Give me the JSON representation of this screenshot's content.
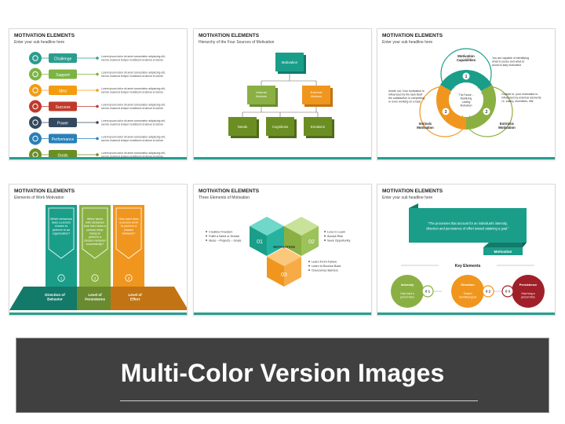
{
  "slides": [
    {
      "title": "MOTIVATION ELEMENTS",
      "subtitle": "Enter your sub headline here",
      "items": [
        "Challenge",
        "Support",
        "Idea",
        "Success",
        "Power",
        "Performance",
        "Goals"
      ],
      "desc_line1": "Lorem ipsum dolor sit amet consectetur adipiscing elit,",
      "desc_line2": "sed do eiusmod tempor incididunt ut labore et dolore",
      "colors": [
        "#2a9d8f",
        "#7cb342",
        "#f39c12",
        "#c0392b",
        "#34495e",
        "#2980b9",
        "#6b8e23"
      ]
    },
    {
      "title": "MOTIVATION ELEMENTS",
      "subtitle": "Hierarchy of the Four Sources of Motivation",
      "root": "Motivation",
      "mid": [
        "Internal Motives",
        "External Motives"
      ],
      "leaves": [
        "Needs",
        "Cognitions",
        "Emotions"
      ]
    },
    {
      "title": "MOTIVATION ELEMENTS",
      "subtitle": "Enter your sub headline here",
      "center": [
        "\"The Factor ...",
        "Mobilizing",
        "Lasting",
        "Motivation"
      ],
      "labels": [
        [
          "Motivation",
          "Capabilities"
        ],
        [
          "Extrinsic",
          "Motivation"
        ],
        [
          "Intrinsic",
          "Motivation"
        ]
      ],
      "nums": [
        "1",
        "2",
        "3"
      ],
      "right_text": [
        "You are  capable of identifying",
        "what to purse and what to",
        "avoid to stay motivated"
      ],
      "left_text": [
        "Inside out: Your motivation is",
        "influenced by the task itself",
        "the satisfaction in completing",
        "or even working on a task"
      ],
      "right2_text": [
        "Outside in: your motivation is",
        "influenced by external elements",
        "i.e. salary, incentives, title"
      ]
    },
    {
      "title": "MOTIVATION ELEMENTS",
      "subtitle": "Elements of Work Motivation",
      "cols": [
        {
          "text": [
            "Which behaviors",
            "does a person",
            "chosen to",
            "perform in an",
            "organization?"
          ],
          "num": "1",
          "label": [
            "Direction of",
            "Behavior"
          ],
          "color": "#1a9e8a",
          "dark": "#137a6a"
        },
        {
          "text": [
            "When faced",
            "with obstacles",
            "how hard does a",
            "person keep",
            "trying to",
            "perform a",
            "chosen behavior",
            "successfully?"
          ],
          "num": "2",
          "label": [
            "Level of",
            "Persistence"
          ],
          "color": "#8ab043",
          "dark": "#6a8a30"
        },
        {
          "text": [
            "How hard does",
            "a person work",
            "to perform a",
            "chosen",
            "behavior?"
          ],
          "num": "3",
          "label": [
            "Level of",
            "Effort"
          ],
          "color": "#f0961e",
          "dark": "#c27414"
        }
      ]
    },
    {
      "title": "MOTIVATION ELEMENTS",
      "subtitle": "Three Elements of Motivation",
      "center": "MOTIVATION",
      "nums": [
        "01",
        "02",
        "03"
      ],
      "list1": [
        "Creative Freedom",
        "Fulfill a Need or Dream",
        "Ideas – Projects – Goals"
      ],
      "list2": [
        "Love to Learn",
        "Accept Risk",
        "Seek Opportunity"
      ],
      "list3": [
        "Learn From Failure",
        "Learn to Bounce Back",
        "Overcomes Barriers"
      ]
    },
    {
      "title": "MOTIVATION ELEMENTS",
      "subtitle": "Enter your sub headline here",
      "quote": [
        "\"The processes that account for an individual's intensity,",
        "direction and persistence of effort toward attaining a goal.\""
      ],
      "ribbon_label": "Motivation",
      "key_title": "Key Elements",
      "circles": [
        {
          "name": "Intensity",
          "sub": [
            "How hard a",
            "person tries"
          ],
          "num": "0 1",
          "color": "#8ab043"
        },
        {
          "name": "Direction",
          "sub": [
            "Toward",
            "beneficial goal"
          ],
          "num": "0 2",
          "color": "#f0961e"
        },
        {
          "name": "Persistence",
          "sub": [
            "How long a",
            "person tries"
          ],
          "num": "0 3",
          "color": "#a0202a"
        }
      ]
    }
  ],
  "banner": "Multi-Color Version Images"
}
